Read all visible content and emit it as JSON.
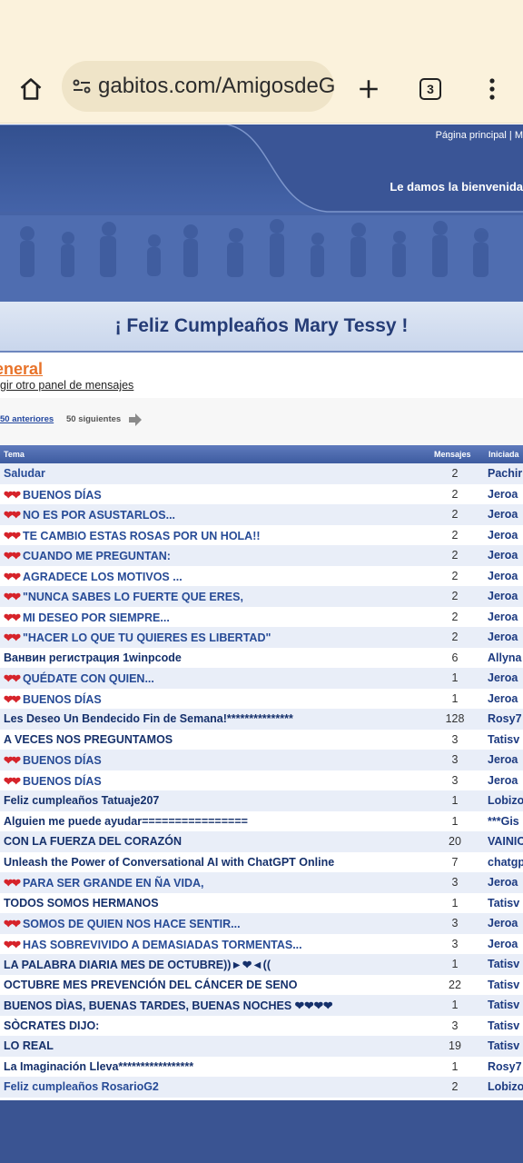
{
  "browser": {
    "url": "gabitos.com/AmigosdeG",
    "tab_count": "3"
  },
  "header": {
    "top_nav": "Página principal  |  M",
    "welcome": "Le damos la bienvenida"
  },
  "birthday_banner": "¡ Feliz Cumpleaños Mary Tessy !",
  "forum": {
    "title": "eneral",
    "other_panel": "gir otro panel de mensajes",
    "prev_link": "50 anteriores",
    "next_label": "50 siguientes"
  },
  "table": {
    "headers": {
      "title": "Tema",
      "messages": "Mensajes",
      "started_by": "Iniciada"
    },
    "rows": [
      {
        "hearts": "",
        "title": "Saludar",
        "count": "2",
        "author": "Pachir"
      },
      {
        "hearts": "❤❤",
        "title": "BUENOS DÍAS",
        "count": "2",
        "author": "Jeroa"
      },
      {
        "hearts": "❤❤",
        "title": "NO ES POR ASUSTARLOS...",
        "count": "2",
        "author": "Jeroa"
      },
      {
        "hearts": "❤❤",
        "title": "TE CAMBIO ESTAS ROSAS POR UN HOLA!!",
        "count": "2",
        "author": "Jeroa"
      },
      {
        "hearts": "❤❤",
        "title": "CUANDO ME PREGUNTAN:",
        "count": "2",
        "author": "Jeroa"
      },
      {
        "hearts": "❤❤",
        "title": "AGRADECE LOS MOTIVOS ...",
        "count": "2",
        "author": "Jeroa"
      },
      {
        "hearts": "❤❤",
        "title": "\"NUNCA SABES LO FUERTE QUE ERES,",
        "count": "2",
        "author": "Jeroa"
      },
      {
        "hearts": "❤❤",
        "title": "MI DESEO POR SIEMPRE...",
        "count": "2",
        "author": "Jeroa"
      },
      {
        "hearts": "❤❤",
        "title": "\"HACER LO QUE TU QUIERES ES LIBERTAD\"",
        "count": "2",
        "author": "Jeroa"
      },
      {
        "hearts": "",
        "title": "Ванвин регистрация 1winpcode",
        "count": "6",
        "author": "Allyna"
      },
      {
        "hearts": "❤❤",
        "title": "QUÉDATE CON QUIEN...",
        "count": "1",
        "author": "Jeroa"
      },
      {
        "hearts": "❤❤",
        "title": "BUENOS DÍAS",
        "count": "1",
        "author": "Jeroa"
      },
      {
        "hearts": "",
        "title": "Les Deseo Un Bendecido Fin de Semana!***************",
        "count": "128",
        "author": "Rosy7"
      },
      {
        "hearts": "",
        "title": "A VECES NOS PREGUNTAMOS",
        "count": "3",
        "author": "Tatisv"
      },
      {
        "hearts": "❤❤",
        "title": "BUENOS DÍAS",
        "count": "3",
        "author": "Jeroa"
      },
      {
        "hearts": "❤❤",
        "title": "BUENOS DÍAS",
        "count": "3",
        "author": "Jeroa"
      },
      {
        "hearts": "",
        "title": "Feliz cumpleaños Tatuaje207",
        "count": "1",
        "author": "Lobizo"
      },
      {
        "hearts": "",
        "title": "Alguien me puede ayudar================",
        "count": "1",
        "author": "***Gis"
      },
      {
        "hearts": "",
        "title": "CON LA FUERZA DEL CORAZÓN",
        "count": "20",
        "author": "VAINIC"
      },
      {
        "hearts": "",
        "title": "Unleash the Power of Conversational AI with ChatGPT Online",
        "count": "7",
        "author": "chatgp"
      },
      {
        "hearts": "❤❤",
        "title": "PARA SER GRANDE EN ÑA VIDA,",
        "count": "3",
        "author": "Jeroa"
      },
      {
        "hearts": "",
        "title": "TODOS SOMOS HERMANOS",
        "count": "1",
        "author": "Tatisv"
      },
      {
        "hearts": "❤❤",
        "title": "SOMOS DE QUIEN NOS HACE SENTIR...",
        "count": "3",
        "author": "Jeroa"
      },
      {
        "hearts": "❤❤",
        "title": "HAS SOBREVIVIDO A DEMASIADAS TORMENTAS...",
        "count": "3",
        "author": "Jeroa"
      },
      {
        "hearts": "",
        "title": "LA PALABRA DIARIA MES DE OCTUBRE))►❤◄((",
        "count": "1",
        "author": "Tatisv"
      },
      {
        "hearts": "",
        "title": "OCTUBRE MES PREVENCIÓN DEL CÁNCER DE SENO",
        "count": "22",
        "author": "Tatisv"
      },
      {
        "hearts": "",
        "title": "BUENOS DÌAS, BUENAS TARDES, BUENAS NOCHES ❤❤❤❤",
        "count": "1",
        "author": "Tatisv"
      },
      {
        "hearts": "",
        "title": "SÒCRATES DIJO:",
        "count": "3",
        "author": "Tatisv"
      },
      {
        "hearts": "",
        "title": "LO REAL",
        "count": "19",
        "author": "Tatisv"
      },
      {
        "hearts": "",
        "title": "La Imaginación Lleva*****************",
        "count": "1",
        "author": "Rosy7"
      },
      {
        "hearts": "",
        "title": "Feliz cumpleaños RosarioG2",
        "count": "2",
        "author": "Lobizo"
      }
    ]
  }
}
